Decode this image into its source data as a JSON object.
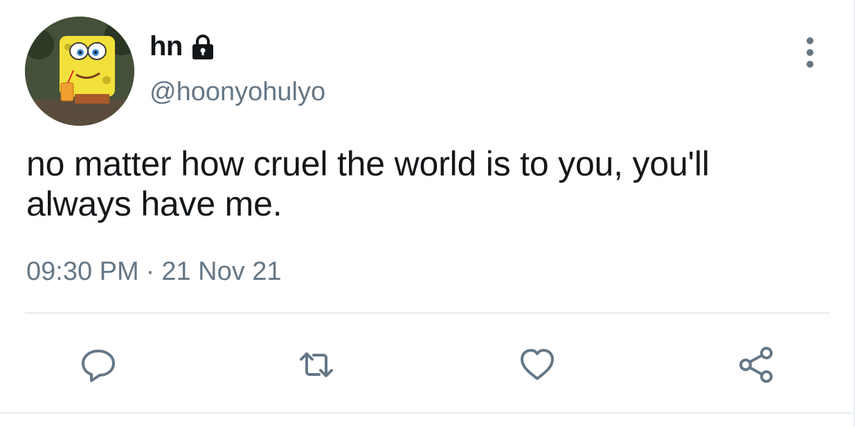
{
  "user": {
    "display_name": "hn",
    "handle": "@hoonyohulyo",
    "avatar_icon": "avatar-image",
    "protected_icon": "lock-icon"
  },
  "tweet": {
    "text": "no matter how cruel the world is to you, you'll always have me.",
    "time": "09:30 PM",
    "separator": "·",
    "date": "21 Nov 21"
  },
  "actions": {
    "reply_icon": "reply-icon",
    "retweet_icon": "retweet-icon",
    "like_icon": "heart-icon",
    "share_icon": "share-icon"
  },
  "colors": {
    "text_primary": "#14171a",
    "text_secondary": "#657786",
    "divider": "#e6ecf0",
    "icon": "#657786"
  }
}
